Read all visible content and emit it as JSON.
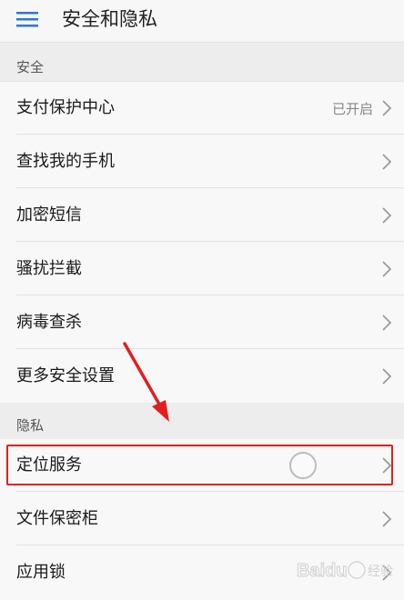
{
  "header": {
    "title": "安全和隐私",
    "menu_icon": "menu-icon"
  },
  "sections": [
    {
      "label": "安全",
      "items": [
        {
          "label": "支付保护中心",
          "status": "已开启"
        },
        {
          "label": "查找我的手机"
        },
        {
          "label": "加密短信"
        },
        {
          "label": "骚扰拦截"
        },
        {
          "label": "病毒查杀"
        },
        {
          "label": "更多安全设置"
        }
      ]
    },
    {
      "label": "隐私",
      "items": [
        {
          "label": "定位服务"
        },
        {
          "label": "文件保密柜"
        },
        {
          "label": "应用锁"
        }
      ]
    }
  ],
  "annotation": {
    "highlight_color": "#e02020",
    "highlighted_item": "定位服务"
  },
  "watermark": {
    "text": "Baidu 经验"
  }
}
